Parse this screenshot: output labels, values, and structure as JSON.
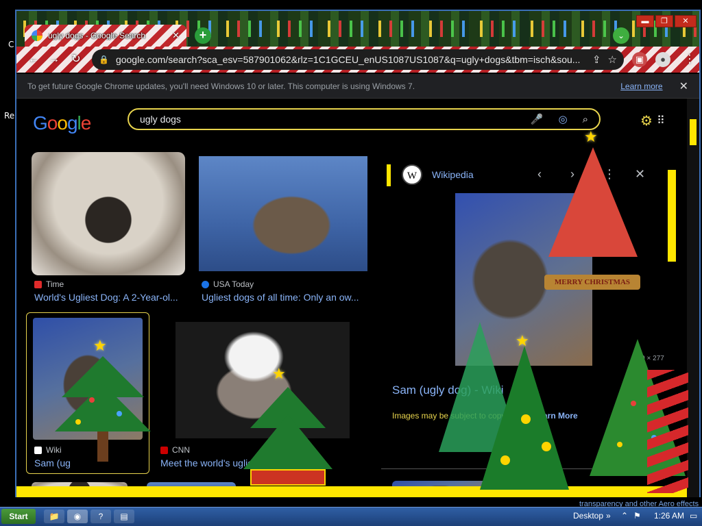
{
  "desktop": {
    "left_labels": [
      "C",
      "Re"
    ]
  },
  "browser": {
    "tab": {
      "title": "ugly dogs - Google Search",
      "close": "✕"
    },
    "new_tab": "+",
    "tab_search": "⌄",
    "window_controls": {
      "minimize": "▬",
      "maximize": "❐",
      "close": "✕"
    },
    "nav": {
      "back": "←",
      "forward": "→",
      "reload": "↻"
    },
    "omnibox": {
      "url": "google.com/search?sca_esv=587901062&rlz=1C1GCEU_enUS1087US1087&q=ugly+dogs&tbm=isch&sou..."
    },
    "infobar": {
      "message": "To get future Google Chrome updates, you'll need Windows 10 or later. This computer is using Windows 7.",
      "link": "Learn more",
      "close": "✕"
    }
  },
  "google": {
    "logo": "Google",
    "query": "ugly dogs",
    "results": [
      {
        "source": "Time",
        "title": "World's Ugliest Dog: A 2-Year-ol...",
        "fav_color": "#e02b2b"
      },
      {
        "source": "USA Today",
        "title": "Ugliest dogs of all time: Only an ow...",
        "fav_color": "#1a73e8"
      },
      {
        "source": "Wiki",
        "title": "Sam (ug",
        "fav_color": "#ffffff"
      },
      {
        "source": "CNN",
        "title": "Meet the world's uglies",
        "fav_color": "#cc0000"
      }
    ],
    "panel": {
      "source": "Wikipedia",
      "title": "Sam (ugly dog) - Wiki",
      "note": "Images may be subject to copyright.",
      "more": "Learn More",
      "dims": "220 × 277"
    }
  },
  "taskbar": {
    "start": "Start",
    "desktop": "Desktop",
    "time": "1:26 AM"
  },
  "decor": {
    "banner_text": "MERRY CHRISTMAS",
    "aero_text": "transparency and other Aero effects"
  },
  "colors": {
    "accent_yellow": "#ffe600",
    "link_blue": "#8ab4f8"
  }
}
